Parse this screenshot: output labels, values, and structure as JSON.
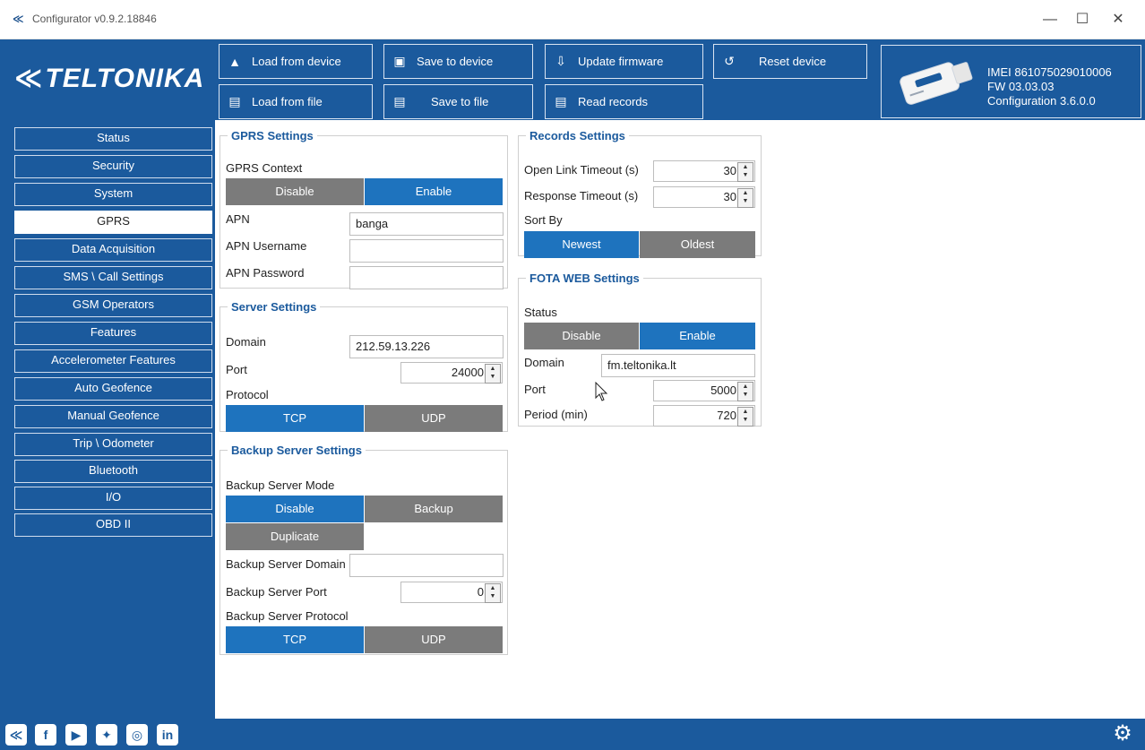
{
  "window": {
    "title": "Configurator v0.9.2.18846",
    "minimize": "—",
    "maximize": "☐",
    "close": "✕"
  },
  "brand": {
    "logo_text": "TELTONIKA"
  },
  "toolbar": {
    "load_from_device": "Load from device",
    "save_to_device": "Save to device",
    "update_firmware": "Update firmware",
    "reset_device": "Reset device",
    "load_from_file": "Load from file",
    "save_to_file": "Save to file",
    "read_records": "Read records"
  },
  "device": {
    "imei": "IMEI 861075029010006",
    "fw": "FW 03.03.03",
    "configuration": "Configuration 3.6.0.0"
  },
  "sidebar": {
    "items": [
      {
        "label": "Status"
      },
      {
        "label": "Security"
      },
      {
        "label": "System"
      },
      {
        "label": "GPRS",
        "active": true
      },
      {
        "label": "Data Acquisition"
      },
      {
        "label": "SMS \\ Call Settings"
      },
      {
        "label": "GSM Operators"
      },
      {
        "label": "Features"
      },
      {
        "label": "Accelerometer Features"
      },
      {
        "label": "Auto Geofence"
      },
      {
        "label": "Manual Geofence"
      },
      {
        "label": "Trip \\ Odometer"
      },
      {
        "label": "Bluetooth"
      },
      {
        "label": "I/O"
      },
      {
        "label": "OBD II"
      }
    ]
  },
  "gprs_settings": {
    "title": "GPRS Settings",
    "context_label": "GPRS Context",
    "disable": "Disable",
    "enable": "Enable",
    "apn_label": "APN",
    "apn_value": "banga",
    "apn_username_label": "APN Username",
    "apn_username_value": "",
    "apn_password_label": "APN Password",
    "apn_password_value": ""
  },
  "server_settings": {
    "title": "Server Settings",
    "domain_label": "Domain",
    "domain_value": "212.59.13.226",
    "port_label": "Port",
    "port_value": "24000",
    "protocol_label": "Protocol",
    "tcp": "TCP",
    "udp": "UDP"
  },
  "backup_server_settings": {
    "title": "Backup Server Settings",
    "mode_label": "Backup Server Mode",
    "disable": "Disable",
    "backup": "Backup",
    "duplicate": "Duplicate",
    "domain_label": "Backup Server Domain",
    "domain_value": "",
    "port_label": "Backup Server Port",
    "port_value": "0",
    "protocol_label": "Backup Server Protocol",
    "tcp": "TCP",
    "udp": "UDP"
  },
  "records_settings": {
    "title": "Records Settings",
    "open_link_timeout_label": "Open Link Timeout (s)",
    "open_link_timeout_value": "30",
    "response_timeout_label": "Response Timeout (s)",
    "response_timeout_value": "30",
    "sort_by_label": "Sort By",
    "newest": "Newest",
    "oldest": "Oldest"
  },
  "fota_web_settings": {
    "title": "FOTA WEB Settings",
    "status_label": "Status",
    "disable": "Disable",
    "enable": "Enable",
    "domain_label": "Domain",
    "domain_value": "fm.teltonika.lt",
    "port_label": "Port",
    "port_value": "5000",
    "period_label": "Period (min)",
    "period_value": "720"
  },
  "footer": {
    "social": [
      "teltonika-icon",
      "facebook-icon",
      "youtube-icon",
      "twitter-icon",
      "instagram-icon",
      "linkedin-icon"
    ],
    "settings_icon": "gear-icon"
  },
  "colors": {
    "brand_blue": "#1b5a9d",
    "selected_blue": "#1e73be",
    "unselected_gray": "#7b7b7b"
  }
}
